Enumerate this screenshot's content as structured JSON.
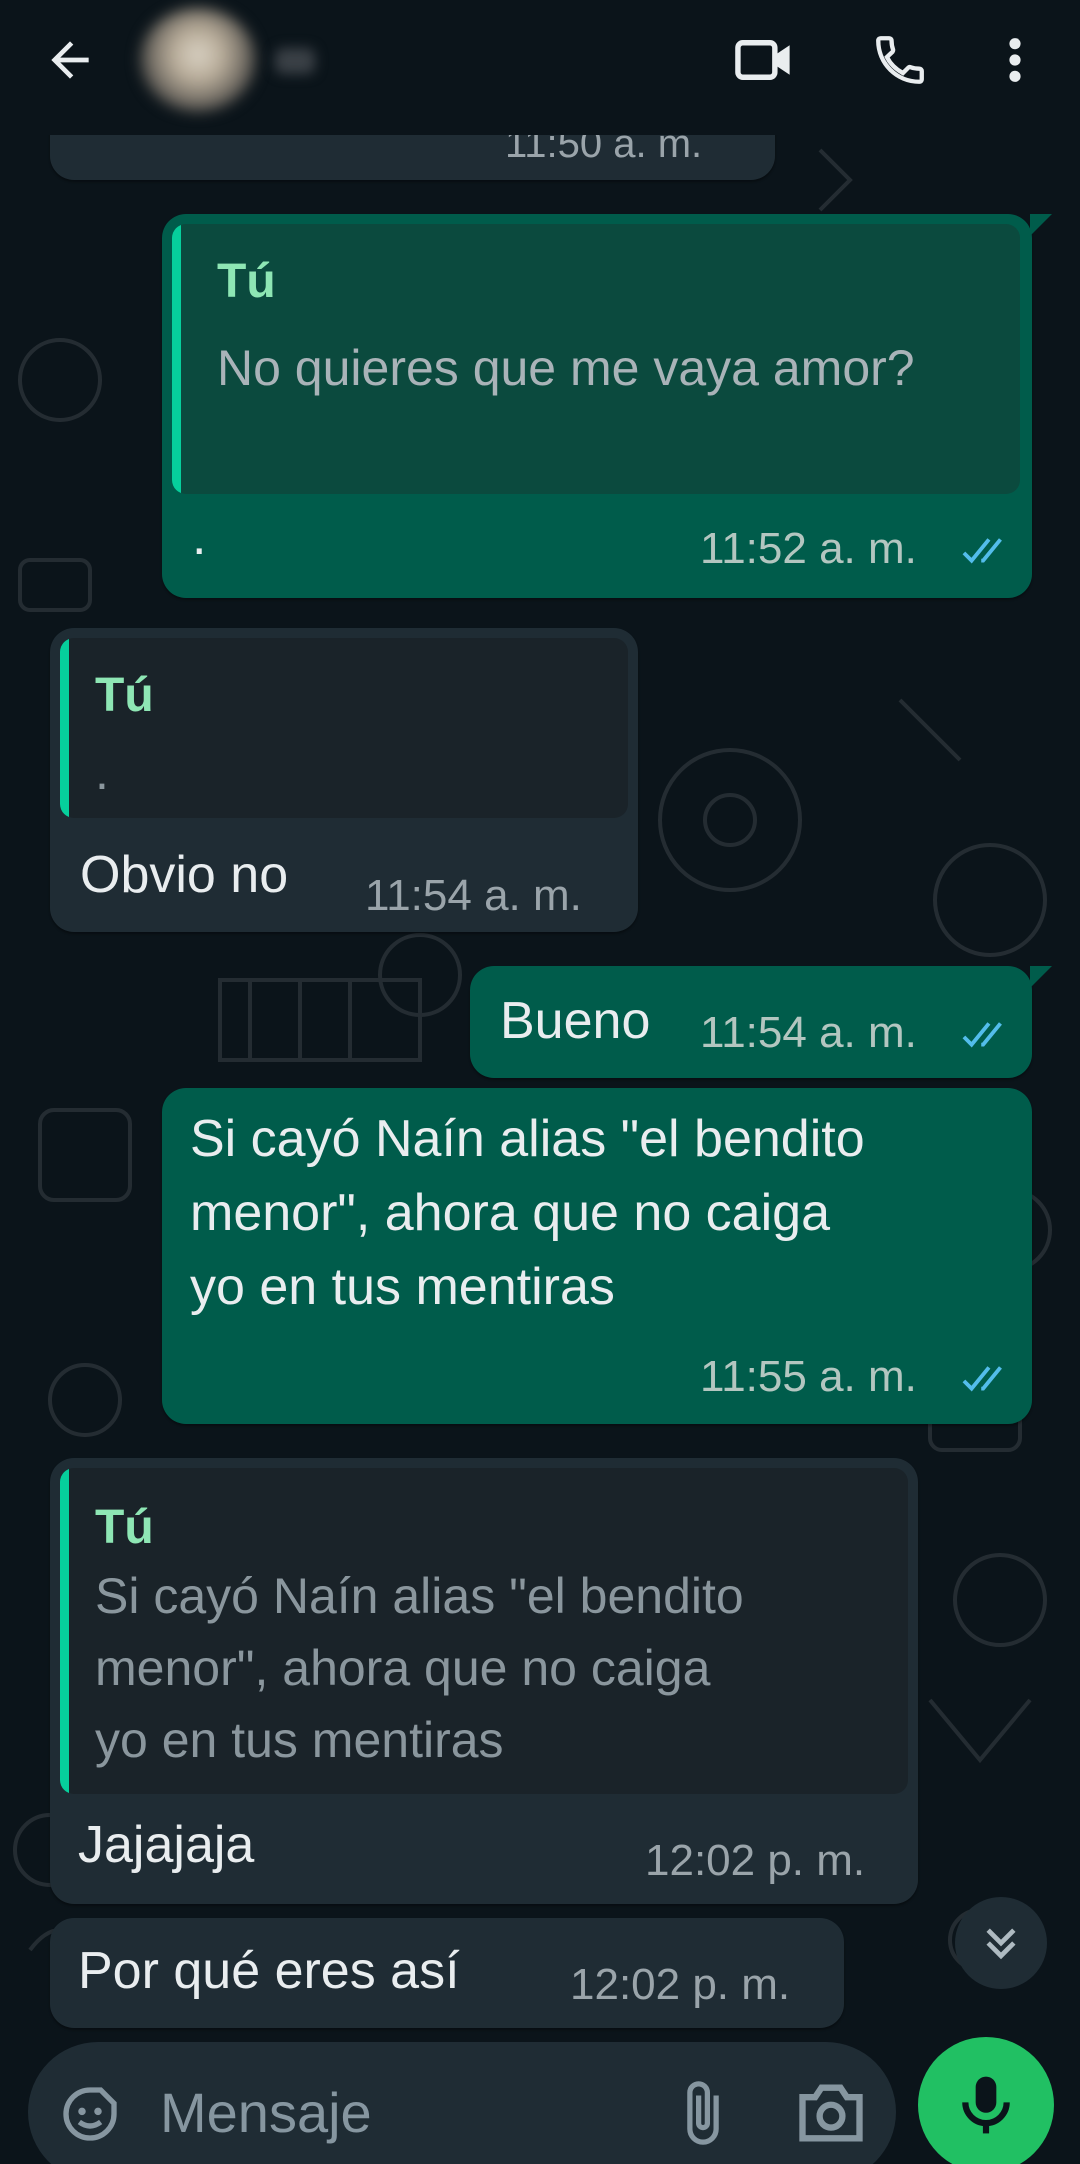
{
  "header": {
    "back_icon": "arrow-left-icon",
    "video_icon": "video-call-icon",
    "call_icon": "phone-icon",
    "menu_icon": "more-vert-icon"
  },
  "messages": [
    {
      "direction": "incoming",
      "time": "11:50 a. m.",
      "partial": true
    },
    {
      "direction": "outgoing",
      "quote_author": "Tú",
      "quote_text": "No quieres que me vaya amor?",
      "text": ".",
      "time": "11:52 a. m.",
      "status": "read"
    },
    {
      "direction": "incoming",
      "quote_author": "Tú",
      "quote_text": ".",
      "text": "Obvio no",
      "time": "11:54 a. m."
    },
    {
      "direction": "outgoing",
      "text": "Bueno",
      "time": "11:54 a. m.",
      "status": "read"
    },
    {
      "direction": "outgoing",
      "text": "Si cayó Naín alias \"el bendito\nmenor\", ahora que no caiga\nyo en tus mentiras",
      "time": "11:55 a. m.",
      "status": "read"
    },
    {
      "direction": "incoming",
      "quote_author": "Tú",
      "quote_text": "Si cayó Naín alias \"el bendito\nmenor\", ahora que no caiga\nyo en tus mentiras",
      "text": "Jajajaja",
      "time": "12:02 p. m."
    },
    {
      "direction": "incoming",
      "text": "Por qué eres así",
      "time": "12:02 p. m."
    }
  ],
  "input": {
    "placeholder": "Mensaje",
    "emoji_icon": "sticker-icon",
    "attach_icon": "paperclip-icon",
    "camera_icon": "camera-icon",
    "mic_icon": "microphone-icon"
  },
  "scroll_icon": "double-chevron-down-icon",
  "colors": {
    "background": "#0b141a",
    "outgoing_bubble": "#005c4b",
    "incoming_bubble": "#1f2c34",
    "quote_accent": "#06cf9c",
    "read_ticks": "#53bdeb",
    "mic_button": "#21c063"
  }
}
